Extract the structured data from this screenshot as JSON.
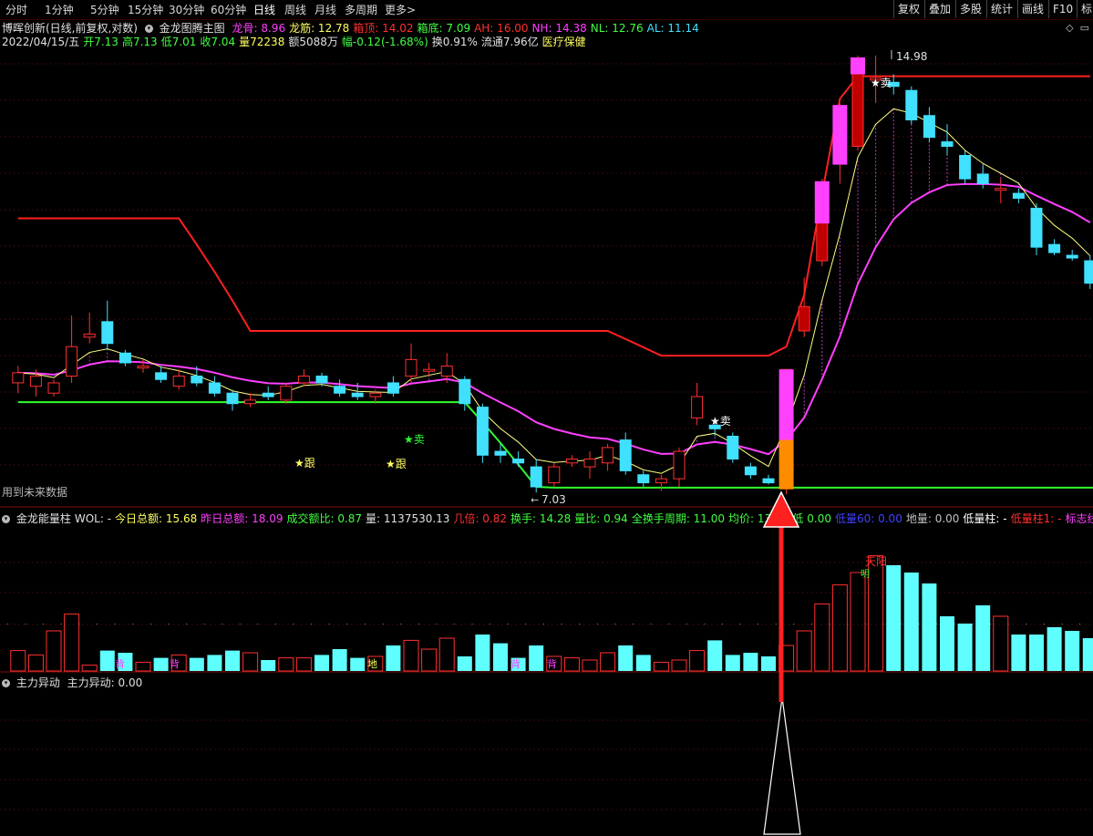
{
  "toolbar": {
    "periods": [
      "分时",
      "1分钟",
      "5分钟",
      "15分钟",
      "30分钟",
      "60分钟",
      "日线",
      "周线",
      "月线",
      "多周期",
      "更多"
    ],
    "active_period": "日线",
    "more_arrow": ">",
    "right_buttons": [
      "复权",
      "叠加",
      "多股",
      "统计",
      "画线",
      "F10",
      "标"
    ]
  },
  "main_header": {
    "stock": "博晖创新(日线,前复权,对数)",
    "indicator": "金龙图腾主图",
    "items": [
      {
        "label": "龙骨: 8.96",
        "color": "#ff40ff"
      },
      {
        "label": "龙筋: 12.78",
        "color": "#ffff60"
      },
      {
        "label": "箱顶: 14.02",
        "color": "#ff3030"
      },
      {
        "label": "箱底: 7.09",
        "color": "#40ff40"
      },
      {
        "label": "AH: 16.00",
        "color": "#ff3030"
      },
      {
        "label": "NH: 14.38",
        "color": "#ff40ff"
      },
      {
        "label": "NL: 12.76",
        "color": "#40ff40"
      },
      {
        "label": "AL: 11.14",
        "color": "#40e0ff"
      }
    ]
  },
  "quote_line": {
    "date": "2022/04/15/五",
    "items": [
      {
        "label": "开7.13",
        "color": "#40ff40"
      },
      {
        "label": "高7.13",
        "color": "#40ff40"
      },
      {
        "label": "低7.01",
        "color": "#40ff40"
      },
      {
        "label": "收7.04",
        "color": "#40ff40"
      },
      {
        "label": "量72238",
        "color": "#ffff60"
      },
      {
        "label": "额5088万",
        "color": "#e0e0e0"
      },
      {
        "label": "幅-0.12(-1.68%)",
        "color": "#40ff40"
      },
      {
        "label": "换0.91%",
        "color": "#e0e0e0"
      },
      {
        "label": "流通7.96亿",
        "color": "#e0e0e0"
      },
      {
        "label": "医疗保健",
        "color": "#ffff60"
      }
    ]
  },
  "annotations": {
    "high_price": "14.98",
    "low_price": "7.03",
    "sell_label": "★卖",
    "follow_label": "★跟",
    "future_data": "用到未来数据",
    "vol_labels": {
      "back": "背",
      "ground": "地",
      "sky_yang": "天阳",
      "bright": "明"
    }
  },
  "volume_header": {
    "title": "金龙能量柱",
    "items": [
      {
        "label": "WOL: -",
        "color": "#e0e0e0"
      },
      {
        "label": "今日总额: 15.68",
        "color": "#ffff60"
      },
      {
        "label": "昨日总额: 18.09",
        "color": "#ff40ff"
      },
      {
        "label": "成交额比: 0.87",
        "color": "#40ff40"
      },
      {
        "label": "量: 1137530.13",
        "color": "#e0e0e0"
      },
      {
        "label": "几倍: 0.82",
        "color": "#ff3030"
      },
      {
        "label": "换手: 14.28",
        "color": "#40ff40"
      },
      {
        "label": "量比: 0.94",
        "color": "#40ff40"
      },
      {
        "label": "全换手周期: 11.00",
        "color": "#40ff40"
      },
      {
        "label": "均价: 13.79",
        "color": "#40ff40"
      },
      {
        "label": "低",
        "color": "#40ff40"
      },
      {
        "label": "0.00",
        "color": "#40ff40"
      },
      {
        "label": "低量60: 0.00",
        "color": "#4040ff"
      },
      {
        "label": "地量: 0.00",
        "color": "#c0c0c0"
      },
      {
        "label": "低量柱: -",
        "color": "#ffffff"
      },
      {
        "label": "低量柱1: -",
        "color": "#ff3030"
      },
      {
        "label": "标志线: -",
        "color": "#ff40ff"
      }
    ]
  },
  "bottom_header": {
    "title": "主力异动",
    "value": "主力异动: 0.00"
  },
  "colors": {
    "up": "#ff3030",
    "down": "#40e0ff",
    "magenta": "#ff40ff",
    "yellow": "#ffff60",
    "green": "#40ff40",
    "arrow": "#ff2020"
  },
  "chart_data": {
    "type": "candlestick",
    "candles": [
      {
        "o": 8.5,
        "h": 8.75,
        "l": 8.35,
        "c": 8.65
      },
      {
        "o": 8.45,
        "h": 8.7,
        "l": 8.3,
        "c": 8.6
      },
      {
        "o": 8.35,
        "h": 8.55,
        "l": 8.3,
        "c": 8.5
      },
      {
        "o": 8.6,
        "h": 9.55,
        "l": 8.5,
        "c": 9.05
      },
      {
        "o": 9.2,
        "h": 9.6,
        "l": 9.1,
        "c": 9.25
      },
      {
        "o": 9.45,
        "h": 9.8,
        "l": 9.0,
        "c": 9.1
      },
      {
        "o": 8.95,
        "h": 9.0,
        "l": 8.75,
        "c": 8.8
      },
      {
        "o": 8.75,
        "h": 8.85,
        "l": 8.65,
        "c": 8.75
      },
      {
        "o": 8.65,
        "h": 8.75,
        "l": 8.5,
        "c": 8.55
      },
      {
        "o": 8.45,
        "h": 8.7,
        "l": 8.4,
        "c": 8.6
      },
      {
        "o": 8.6,
        "h": 8.75,
        "l": 8.45,
        "c": 8.5
      },
      {
        "o": 8.5,
        "h": 8.6,
        "l": 8.3,
        "c": 8.35
      },
      {
        "o": 8.35,
        "h": 8.4,
        "l": 8.1,
        "c": 8.2
      },
      {
        "o": 8.2,
        "h": 8.35,
        "l": 8.15,
        "c": 8.25
      },
      {
        "o": 8.35,
        "h": 8.45,
        "l": 8.25,
        "c": 8.3
      },
      {
        "o": 8.25,
        "h": 8.5,
        "l": 8.2,
        "c": 8.45
      },
      {
        "o": 8.5,
        "h": 8.7,
        "l": 8.45,
        "c": 8.6
      },
      {
        "o": 8.6,
        "h": 8.65,
        "l": 8.45,
        "c": 8.5
      },
      {
        "o": 8.45,
        "h": 8.55,
        "l": 8.3,
        "c": 8.35
      },
      {
        "o": 8.35,
        "h": 8.5,
        "l": 8.25,
        "c": 8.3
      },
      {
        "o": 8.3,
        "h": 8.4,
        "l": 8.2,
        "c": 8.35
      },
      {
        "o": 8.5,
        "h": 8.6,
        "l": 8.3,
        "c": 8.35
      },
      {
        "o": 8.6,
        "h": 9.1,
        "l": 8.5,
        "c": 8.85
      },
      {
        "o": 8.7,
        "h": 8.8,
        "l": 8.6,
        "c": 8.7
      },
      {
        "o": 8.6,
        "h": 8.95,
        "l": 8.5,
        "c": 8.75
      },
      {
        "o": 8.55,
        "h": 8.6,
        "l": 8.1,
        "c": 8.2
      },
      {
        "o": 8.15,
        "h": 8.2,
        "l": 7.4,
        "c": 7.5
      },
      {
        "o": 7.55,
        "h": 7.65,
        "l": 7.4,
        "c": 7.5
      },
      {
        "o": 7.45,
        "h": 7.55,
        "l": 7.35,
        "c": 7.4
      },
      {
        "o": 7.35,
        "h": 7.45,
        "l": 7.03,
        "c": 7.1
      },
      {
        "o": 7.15,
        "h": 7.4,
        "l": 7.1,
        "c": 7.35
      },
      {
        "o": 7.4,
        "h": 7.5,
        "l": 7.35,
        "c": 7.45
      },
      {
        "o": 7.35,
        "h": 7.55,
        "l": 7.2,
        "c": 7.45
      },
      {
        "o": 7.4,
        "h": 7.65,
        "l": 7.3,
        "c": 7.6
      },
      {
        "o": 7.7,
        "h": 7.8,
        "l": 7.25,
        "c": 7.3
      },
      {
        "o": 7.25,
        "h": 7.3,
        "l": 7.1,
        "c": 7.15
      },
      {
        "o": 7.15,
        "h": 7.25,
        "l": 7.05,
        "c": 7.2
      },
      {
        "o": 7.2,
        "h": 7.6,
        "l": 7.1,
        "c": 7.55
      },
      {
        "o": 8.0,
        "h": 8.5,
        "l": 7.9,
        "c": 8.3
      },
      {
        "o": 7.9,
        "h": 8.0,
        "l": 7.75,
        "c": 7.85
      },
      {
        "o": 7.75,
        "h": 7.8,
        "l": 7.4,
        "c": 7.45
      },
      {
        "o": 7.35,
        "h": 7.4,
        "l": 7.2,
        "c": 7.25
      },
      {
        "o": 7.2,
        "h": 7.25,
        "l": 7.13,
        "c": 7.15
      },
      {
        "o": 7.13,
        "h": 8.7,
        "l": 7.01,
        "c": 8.7
      },
      {
        "o": 9.3,
        "h": 10.2,
        "l": 9.2,
        "c": 9.7
      },
      {
        "o": 10.5,
        "h": 12.1,
        "l": 10.4,
        "c": 11.6
      },
      {
        "o": 12.8,
        "h": 13.8,
        "l": 12.0,
        "c": 12.8
      },
      {
        "o": 12.8,
        "h": 14.98,
        "l": 12.7,
        "c": 14.9
      },
      {
        "o": 14.4,
        "h": 14.98,
        "l": 13.8,
        "c": 14.4
      },
      {
        "o": 14.3,
        "h": 14.5,
        "l": 14.0,
        "c": 14.2
      },
      {
        "o": 14.1,
        "h": 14.2,
        "l": 13.3,
        "c": 13.4
      },
      {
        "o": 13.5,
        "h": 13.7,
        "l": 12.9,
        "c": 13.0
      },
      {
        "o": 12.9,
        "h": 13.3,
        "l": 12.6,
        "c": 12.8
      },
      {
        "o": 12.6,
        "h": 12.7,
        "l": 12.0,
        "c": 12.1
      },
      {
        "o": 12.2,
        "h": 12.4,
        "l": 11.9,
        "c": 12.0
      },
      {
        "o": 11.9,
        "h": 12.1,
        "l": 11.6,
        "c": 11.9
      },
      {
        "o": 11.8,
        "h": 11.9,
        "l": 11.6,
        "c": 11.7
      },
      {
        "o": 11.5,
        "h": 11.6,
        "l": 10.6,
        "c": 10.75
      },
      {
        "o": 10.8,
        "h": 10.9,
        "l": 10.6,
        "c": 10.65
      },
      {
        "o": 10.6,
        "h": 10.7,
        "l": 10.5,
        "c": 10.55
      },
      {
        "o": 10.5,
        "h": 10.6,
        "l": 10.0,
        "c": 10.1
      }
    ],
    "volumes": [
      0.28,
      0.22,
      0.55,
      0.78,
      0.08,
      0.28,
      0.25,
      0.12,
      0.18,
      0.22,
      0.18,
      0.22,
      0.28,
      0.25,
      0.15,
      0.18,
      0.18,
      0.22,
      0.3,
      0.18,
      0.2,
      0.35,
      0.42,
      0.3,
      0.45,
      0.2,
      0.5,
      0.38,
      0.18,
      0.35,
      0.2,
      0.18,
      0.15,
      0.25,
      0.35,
      0.22,
      0.12,
      0.15,
      0.28,
      0.42,
      0.22,
      0.25,
      0.2,
      0.35,
      0.55,
      0.92,
      1.18,
      1.35,
      1.58,
      1.45,
      1.35,
      1.2,
      0.75,
      0.65,
      0.9,
      0.75,
      0.5,
      0.5,
      0.6,
      0.55,
      0.45
    ],
    "lines": {
      "box_top_red": "stepped: 11.3 → 9.3 → 8.9 → 14.4",
      "box_bottom_green": "8.2 → 7.09",
      "dragon_bone_magenta": "8.4 → 7.2 → 11.6",
      "dragon_tendon_yellow": "8.6 → 7.3 → 14.3 → 11.7"
    },
    "ylim": [
      7.0,
      15.0
    ],
    "grid": true
  }
}
